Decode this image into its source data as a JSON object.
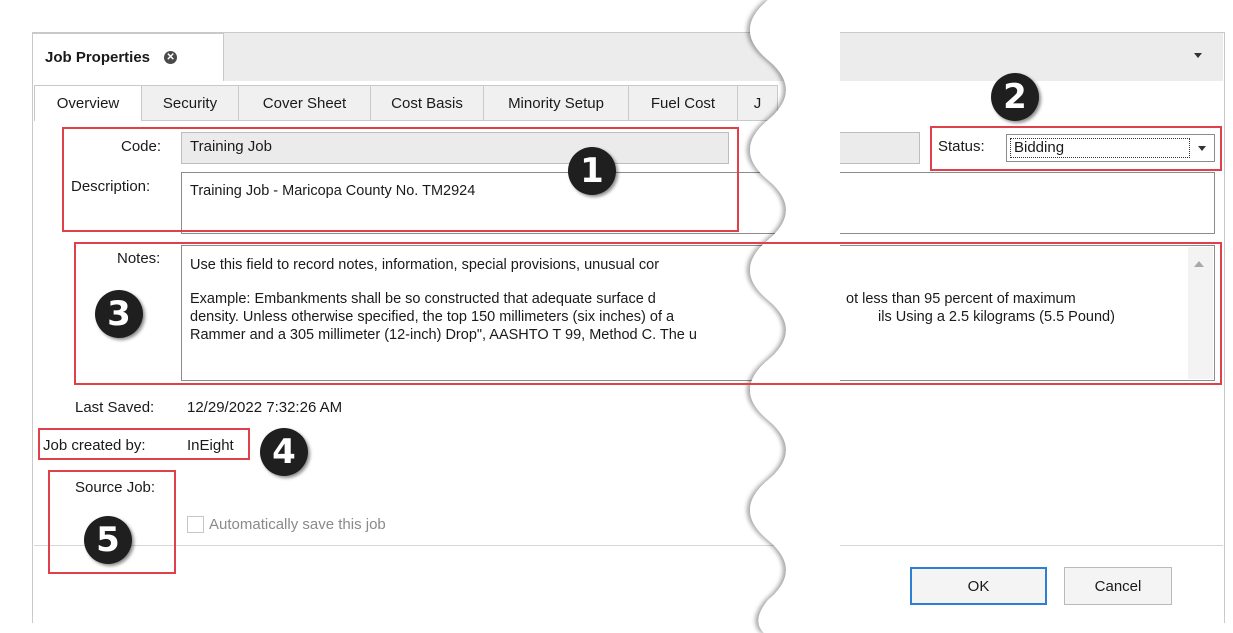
{
  "window": {
    "title": "Job Properties"
  },
  "tabs": [
    "Overview",
    "Security",
    "Cover Sheet",
    "Cost Basis",
    "Minority Setup",
    "Fuel Cost",
    "J"
  ],
  "form": {
    "code_label": "Code:",
    "code_value": "Training Job",
    "description_label": "Description:",
    "description_value": "Training Job - Maricopa County No. TM2924",
    "status_label": "Status:",
    "status_value": "Bidding",
    "notes_label": "Notes:",
    "notes_line1": "Use this field to record notes, information, special provisions, unusual cor",
    "notes_line2_left": "Example:  Embankments shall be so constructed that adequate surface d",
    "notes_line2_right": "ot less than 95 percent of maximum",
    "notes_line3_left": "density. Unless otherwise specified, the top 150 millimeters (six inches) of a",
    "notes_line3_right": "ils Using a 2.5 kilograms (5.5 Pound)",
    "notes_line4_left": "Rammer and a 305 millimeter (12-inch) Drop\", AASHTO T 99, Method C. The u",
    "last_saved_label": "Last Saved:",
    "last_saved_value": "12/29/2022 7:32:26 AM",
    "created_by_label": "Job created by:",
    "created_by_value": "InEight",
    "source_job_label": "Source Job:",
    "autosave_label": "Automatically save this job"
  },
  "buttons": {
    "ok": "OK",
    "cancel": "Cancel"
  },
  "badges": [
    "1",
    "2",
    "3",
    "4",
    "5"
  ],
  "colors": {
    "highlight": "#e0404a",
    "badge": "#1f1f1f",
    "ok_border": "#2d7fd3"
  }
}
